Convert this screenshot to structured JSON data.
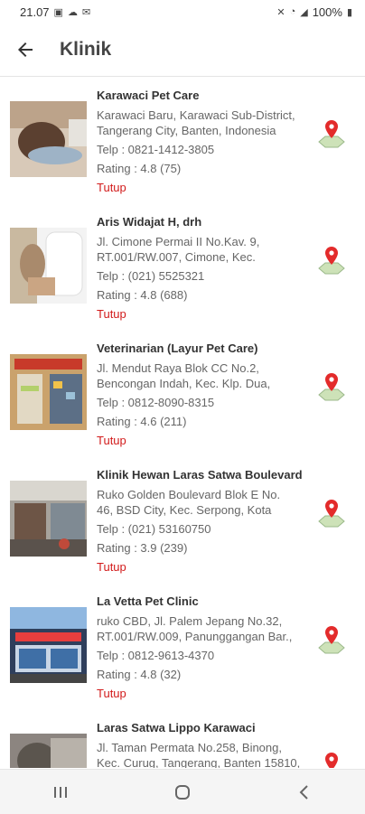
{
  "status_bar": {
    "time": "21.07",
    "battery": "100%"
  },
  "app_bar": {
    "title": "Klinik"
  },
  "clinics": [
    {
      "name": "Karawaci Pet Care",
      "address": "Karawaci Baru, Karawaci Sub-District,\nTangerang City, Banten, Indonesia",
      "phone": "Telp : 0821-1412-3805",
      "rating": "Rating : 4.8 (75)",
      "status": "Tutup"
    },
    {
      "name": "Aris Widajat H, drh",
      "address": "Jl. Cimone Permai II No.Kav. 9,\nRT.001/RW.007, Cimone, Kec.",
      "phone": "Telp : (021) 5525321",
      "rating": "Rating : 4.8 (688)",
      "status": "Tutup"
    },
    {
      "name": "Veterinarian (Layur Pet Care)",
      "address": "Jl. Mendut Raya Blok CC No.2,\nBencongan Indah, Kec. Klp. Dua,",
      "phone": "Telp : 0812-8090-8315",
      "rating": "Rating : 4.6 (211)",
      "status": "Tutup"
    },
    {
      "name": "Klinik Hewan Laras Satwa Boulevard",
      "address": "Ruko Golden Boulevard Blok E No.\n46, BSD City, Kec. Serpong, Kota",
      "phone": "Telp : (021) 53160750",
      "rating": "Rating : 3.9 (239)",
      "status": "Tutup"
    },
    {
      "name": "La Vetta Pet Clinic",
      "address": "ruko CBD, Jl. Palem Jepang No.32,\nRT.001/RW.009, Panunggangan Bar.,",
      "phone": "Telp : 0812-9613-4370",
      "rating": "Rating : 4.8 (32)",
      "status": "Tutup"
    },
    {
      "name": "Laras Satwa Lippo Karawaci",
      "address": "Jl. Taman Permata No.258, Binong,\nKec. Curug, Tangerang, Banten 15810,",
      "phone": "",
      "rating": "",
      "status": ""
    }
  ]
}
